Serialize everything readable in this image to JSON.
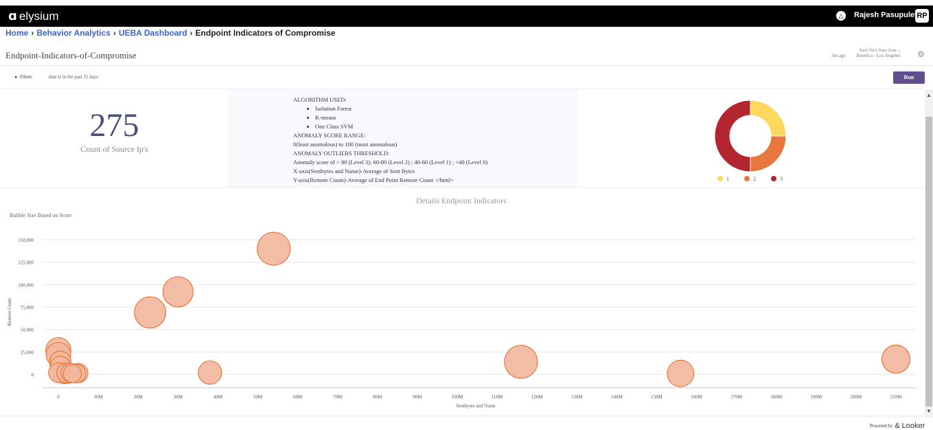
{
  "app": {
    "logo_text": "elysium",
    "user_name": "Rajesh Pasupuleti",
    "user_initials": "RP"
  },
  "breadcrumb": {
    "items": [
      "Home",
      "Behavior Analytics",
      "UEBA Dashboard"
    ],
    "current": "Endpoint Indicators of Compromise",
    "separator": "›"
  },
  "dashboard": {
    "title": "Endpoint-Indicators-of-Compromise",
    "timezone_label": "Each Tile's Time Zone",
    "last_run": "3m ago",
    "timezone_value": "America - Los Angeles",
    "filters_label": "Filters",
    "filters_description": "date is in the past 15 days",
    "run_label": "Run"
  },
  "kpi": {
    "value": "275",
    "label": "Count of Source Ip's"
  },
  "info": {
    "algorithm_heading": "ALGORITHM USED:",
    "algorithms": [
      "Isolation Forest",
      "K-means",
      "One Class SVM"
    ],
    "lines": [
      "ANOMALY SCORE RANGE:",
      "0(least anomalous) to 100 (most anomalous)",
      "ANOMALY OUTLIERS THRESHOLD:",
      "Anomaly score of > 80 (Level 3); 60-80 (Level 2) ; 40-60 (Level 1) ; <40 (Level 0)",
      "X-axis(Sentbytes and Name)-Average of Sent Bytes",
      "Y-axis(Remote Count)-Average of End Point Remote Count </html>"
    ]
  },
  "chart_data": [
    {
      "type": "pie",
      "subtype": "donut",
      "title": "",
      "categories": [
        "1",
        "2",
        "3"
      ],
      "values": [
        25,
        25,
        50
      ],
      "colors": [
        "#fcd95e",
        "#e8773d",
        "#b3262f"
      ],
      "legend": "bottom"
    },
    {
      "type": "scatter",
      "subtype": "bubble",
      "title": "Details Endpoint Indicators",
      "subtitle": "Bubble Size Based on Score",
      "xlabel": "Sentbytes and Name",
      "ylabel": "Remote Count",
      "xlim": [
        -4000000,
        215000000
      ],
      "ylim": [
        -15000,
        165000
      ],
      "x_ticks": [
        "0",
        "10M",
        "20M",
        "30M",
        "40M",
        "50M",
        "60M",
        "70M",
        "80M",
        "90M",
        "100M",
        "110M",
        "120M",
        "130M",
        "140M",
        "150M",
        "160M",
        "170M",
        "180M",
        "190M",
        "200M",
        "210M"
      ],
      "y_ticks": [
        "0",
        "25,000",
        "50,000",
        "75,000",
        "100,000",
        "125,000",
        "150,000"
      ],
      "grid": true,
      "color": "#e8773d",
      "points": [
        {
          "x": 54000000,
          "y": 140000,
          "size": 100
        },
        {
          "x": 30000000,
          "y": 92000,
          "size": 84
        },
        {
          "x": 23000000,
          "y": 69000,
          "size": 90
        },
        {
          "x": 116000000,
          "y": 14000,
          "size": 100
        },
        {
          "x": 210000000,
          "y": 17000,
          "size": 73
        },
        {
          "x": 156000000,
          "y": 1000,
          "size": 65
        },
        {
          "x": 38000000,
          "y": 2000,
          "size": 50
        },
        {
          "x": 0,
          "y": 27000,
          "size": 58
        },
        {
          "x": 0,
          "y": 22000,
          "size": 55
        },
        {
          "x": 500000,
          "y": 14000,
          "size": 42
        },
        {
          "x": 500000,
          "y": 9000,
          "size": 38
        },
        {
          "x": 0,
          "y": 2000,
          "size": 35
        },
        {
          "x": 1000000,
          "y": 2000,
          "size": 40
        },
        {
          "x": 1500000,
          "y": 1000,
          "size": 38
        },
        {
          "x": 2000000,
          "y": 1500,
          "size": 34
        },
        {
          "x": 2500000,
          "y": 1000,
          "size": 36
        },
        {
          "x": 3000000,
          "y": 2000,
          "size": 32
        },
        {
          "x": 3500000,
          "y": 1000,
          "size": 30
        },
        {
          "x": 4500000,
          "y": 1000,
          "size": 32
        },
        {
          "x": 5000000,
          "y": 1500,
          "size": 34
        }
      ]
    }
  ]
}
